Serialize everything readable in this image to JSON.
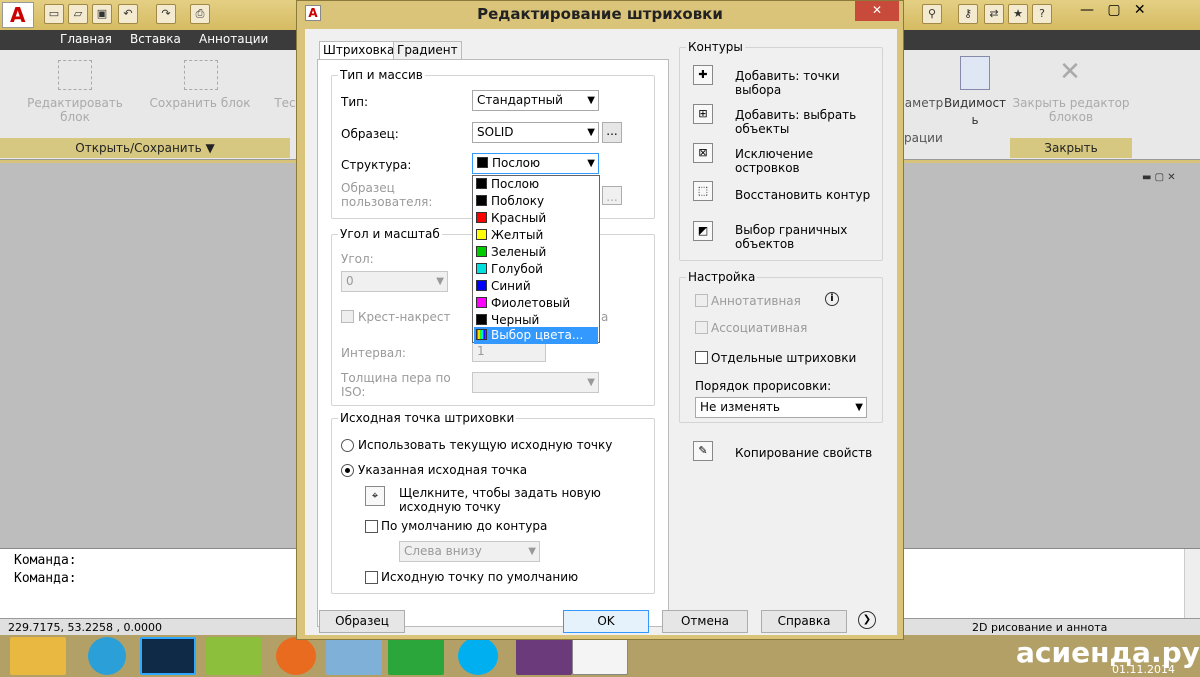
{
  "app": {
    "menu": [
      "Главная",
      "Вставка",
      "Аннотации"
    ],
    "ribbon": {
      "edit_block": "Редактировать блок",
      "save_block": "Сохранить блок",
      "partial_left": "Тес",
      "partial_param": "аметр",
      "partial_param2": "рации",
      "visibility": "Видимост",
      "visibility2": "ь",
      "close_editor": "Закрыть редактор блоков",
      "open_save_footer": "Открыть/Сохранить",
      "close_footer": "Закрыть"
    },
    "command_lines": [
      "Команда:",
      "Команда:"
    ],
    "coords": "229.7175,  53.2258 , 0.0000",
    "workspace": "2D рисование и аннота",
    "watermark": "асиенда.ру",
    "date": "01.11.2014"
  },
  "dialog": {
    "title": "Редактирование штриховки",
    "close": "✕",
    "tabs": [
      "Штриховка",
      "Градиент"
    ],
    "type_group": {
      "title": "Тип и массив",
      "type_label": "Тип:",
      "type_value": "Стандартный",
      "pattern_label": "Образец:",
      "pattern_value": "SOLID",
      "pattern_btn": "...",
      "structure_label": "Структура:",
      "structure_value": "Послою",
      "custom_label1": "Образец",
      "custom_label2": "пользователя:"
    },
    "angle_group": {
      "title": "Угол и масштаб",
      "angle_label": "Угол:",
      "angle_value": "0",
      "cross_label": "Крест-накрест",
      "partial_right": "а",
      "interval_label": "Интервал:",
      "interval_value": "1",
      "pen_label1": "Толщина пера по",
      "pen_label2": "ISO:"
    },
    "origin_group": {
      "title": "Исходная точка штриховки",
      "use_current": "Использовать текущую исходную точку",
      "specified": "Указанная исходная точка",
      "click_new1": "Щелкните, чтобы задать новую",
      "click_new2": "исходную точку",
      "default_boundary": "По умолчанию до контура",
      "bottom_left": "Слева внизу",
      "store_default": "Исходную точку по умолчанию"
    },
    "dropdown": [
      {
        "label": "Послою",
        "color": "#000000"
      },
      {
        "label": "Поблоку",
        "color": "#000000"
      },
      {
        "label": "Красный",
        "color": "#ff0000"
      },
      {
        "label": "Желтый",
        "color": "#ffff00"
      },
      {
        "label": "Зеленый",
        "color": "#00cc00"
      },
      {
        "label": "Голубой",
        "color": "#00e0e0"
      },
      {
        "label": "Синий",
        "color": "#0000ff"
      },
      {
        "label": "Фиолетовый",
        "color": "#ff00ff"
      },
      {
        "label": "Черный",
        "color": "#000000"
      },
      {
        "label": "Выбор цвета...",
        "color": "#888888"
      }
    ],
    "boundaries": {
      "title": "Контуры",
      "add_pick1": "Добавить: точки",
      "add_pick2": "выбора",
      "add_select1": "Добавить: выбрать",
      "add_select2": "объекты",
      "remove1": "Исключение",
      "remove2": "островков",
      "recreate": "Восстановить контур",
      "view1": "Выбор граничных",
      "view2": "объектов"
    },
    "options": {
      "title": "Настройка",
      "annotative": "Аннотативная",
      "associative": "Ассоциативная",
      "separate": "Отдельные штриховки",
      "draw_order_label": "Порядок прорисовки:",
      "draw_order_value": "Не изменять"
    },
    "inherit": "Копирование свойств",
    "buttons": {
      "preview": "Образец",
      "ok": "OK",
      "cancel": "Отмена",
      "help": "Справка"
    }
  }
}
